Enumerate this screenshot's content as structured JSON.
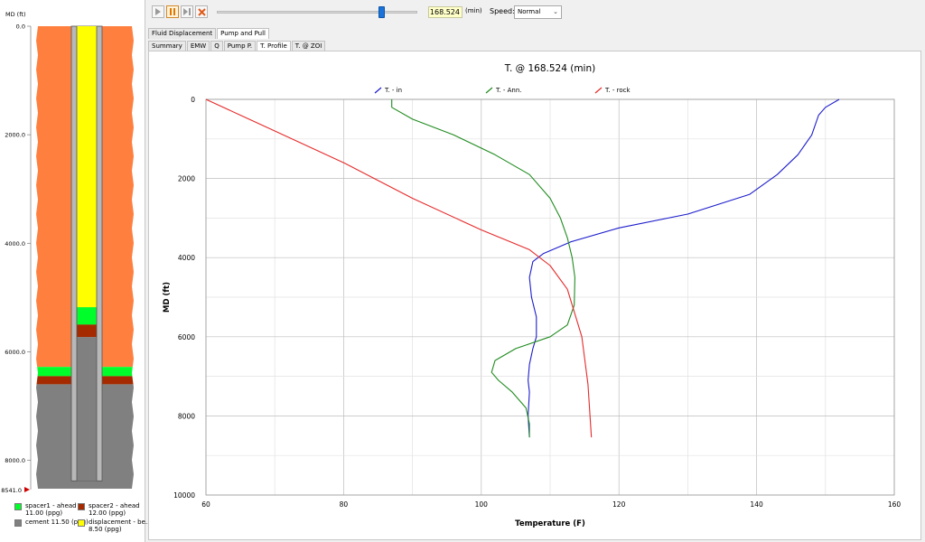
{
  "well": {
    "md_label": "MD (ft)",
    "depth_labels": [
      "0.0",
      "2000.0",
      "4000.0",
      "6000.0",
      "8000.0"
    ],
    "depth_values": [
      0,
      2000,
      4000,
      6000,
      8000
    ],
    "bottom_label": "8541.0",
    "total_depth": 8541,
    "intervals_annulus": [
      {
        "fluid": "formation",
        "from": 0,
        "to": 6280
      },
      {
        "fluid": "spacer1",
        "from": 6280,
        "to": 6450
      },
      {
        "fluid": "spacer2",
        "from": 6450,
        "to": 6600
      },
      {
        "fluid": "cement",
        "from": 6600,
        "to": 8541
      }
    ],
    "intervals_pipe": [
      {
        "fluid": "displacement",
        "from": 0,
        "to": 5180
      },
      {
        "fluid": "spacer1",
        "from": 5180,
        "to": 5500
      },
      {
        "fluid": "spacer2",
        "from": 5500,
        "to": 5730
      },
      {
        "fluid": "cement",
        "from": 5730,
        "to": 8541
      }
    ],
    "pipe_bottom": 8380,
    "colors": {
      "formation": "#ff7f3f",
      "spacer1": "#00ff2a",
      "spacer2": "#a52a00",
      "cement": "#808080",
      "displacement": "#ffff00"
    }
  },
  "legend": [
    {
      "color": "#00ff2a",
      "line1": "spacer1 - ahead",
      "line2": "11.00 (ppg)"
    },
    {
      "color": "#a52a00",
      "line1": "spacer2 - ahead",
      "line2": "12.00 (ppg)"
    },
    {
      "color": "#808080",
      "line1": "cement 11.50 (ppg)",
      "line2": ""
    },
    {
      "color": "#ffff00",
      "line1": "displacement - be...",
      "line2": "8.50 (ppg)"
    }
  ],
  "toolbar": {
    "play_icon": "play-icon",
    "pause_icon": "pause-icon",
    "step_icon": "step-forward-icon",
    "stop_icon": "stop-icon",
    "slider_fraction": 0.82,
    "time_value": "168.524",
    "time_unit": "(min)",
    "speed_label": "Speed:",
    "speed_value": "Normal"
  },
  "tabs_top": [
    "Fluid Displacement",
    "Pump and Pull"
  ],
  "tabs_top_active": 1,
  "tabs_sub": [
    "Summary",
    "EMW",
    "Q",
    "Pump P.",
    "T. Profile",
    "T. @ ZOI"
  ],
  "tabs_sub_active": 4,
  "chart_data": {
    "type": "line",
    "title": "T. @ 168.524 (min)",
    "xlabel": "Temperature (F)",
    "ylabel": "MD (ft)",
    "xlim": [
      60,
      160
    ],
    "ylim": [
      0,
      10000
    ],
    "y_inverted": true,
    "x_ticks": [
      60,
      80,
      100,
      120,
      140,
      160
    ],
    "y_ticks": [
      0,
      2000,
      4000,
      6000,
      8000,
      10000
    ],
    "grid": true,
    "legend_position": "top",
    "series": [
      {
        "name": "T. - in",
        "color": "#1c1ccc",
        "points": [
          [
            152,
            0
          ],
          [
            150,
            200
          ],
          [
            149,
            400
          ],
          [
            148,
            900
          ],
          [
            146,
            1400
          ],
          [
            143,
            1900
          ],
          [
            139,
            2400
          ],
          [
            130,
            2900
          ],
          [
            120,
            3250
          ],
          [
            113,
            3600
          ],
          [
            109,
            3900
          ],
          [
            107.5,
            4100
          ],
          [
            107,
            4500
          ],
          [
            107.3,
            5000
          ],
          [
            108,
            5500
          ],
          [
            108,
            6000
          ],
          [
            107.5,
            6300
          ],
          [
            107,
            6700
          ],
          [
            106.8,
            7100
          ],
          [
            107,
            7400
          ],
          [
            106.8,
            8000
          ],
          [
            107,
            8541
          ]
        ]
      },
      {
        "name": "T. - Ann.",
        "color": "#1f8b1f",
        "points": [
          [
            87,
            0
          ],
          [
            87,
            200
          ],
          [
            90,
            500
          ],
          [
            96,
            900
          ],
          [
            102,
            1400
          ],
          [
            107,
            1900
          ],
          [
            110,
            2500
          ],
          [
            111.5,
            3000
          ],
          [
            112.5,
            3500
          ],
          [
            113.2,
            4000
          ],
          [
            113.6,
            4500
          ],
          [
            113.5,
            5200
          ],
          [
            112.5,
            5700
          ],
          [
            110,
            6000
          ],
          [
            105,
            6300
          ],
          [
            102,
            6600
          ],
          [
            101.5,
            6900
          ],
          [
            102.5,
            7100
          ],
          [
            104.5,
            7400
          ],
          [
            106.5,
            7800
          ],
          [
            107,
            8200
          ],
          [
            107,
            8541
          ]
        ]
      },
      {
        "name": "T. - rock",
        "color": "#e62a2a",
        "points": [
          [
            60,
            0
          ],
          [
            70,
            800
          ],
          [
            80,
            1600
          ],
          [
            90,
            2500
          ],
          [
            100,
            3300
          ],
          [
            107,
            3800
          ],
          [
            110,
            4200
          ],
          [
            112.5,
            4800
          ],
          [
            114.6,
            6000
          ],
          [
            115.5,
            7200
          ],
          [
            116,
            8541
          ]
        ]
      }
    ]
  }
}
